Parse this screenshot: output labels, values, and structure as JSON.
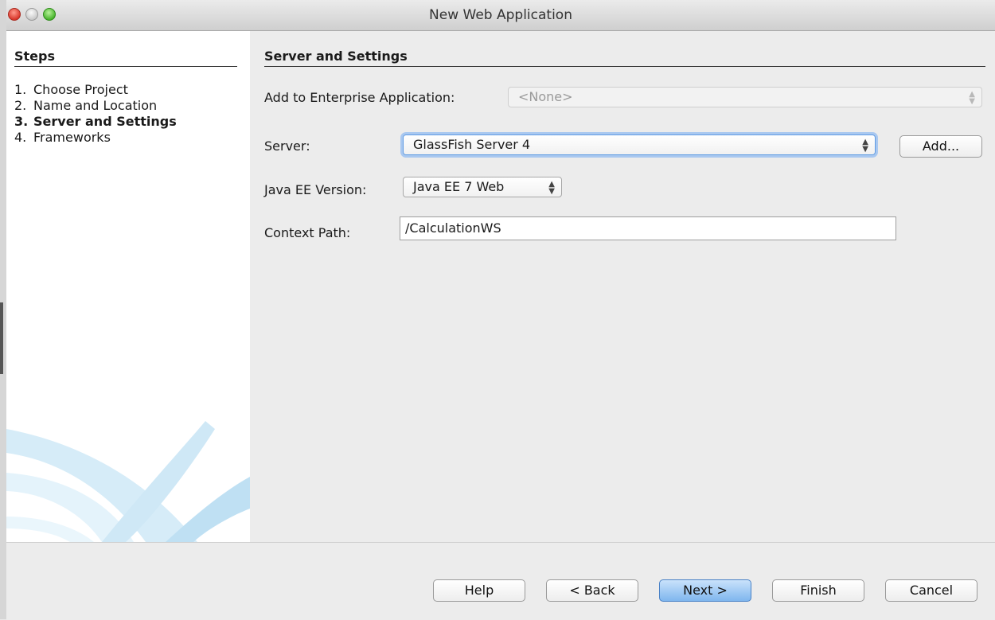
{
  "window": {
    "title": "New Web Application"
  },
  "steps": {
    "header": "Steps",
    "items": [
      {
        "num": "1.",
        "label": "Choose Project"
      },
      {
        "num": "2.",
        "label": "Name and Location"
      },
      {
        "num": "3.",
        "label": "Server and Settings"
      },
      {
        "num": "4.",
        "label": "Frameworks"
      }
    ],
    "current_index": 2
  },
  "section": {
    "title": "Server and Settings"
  },
  "form": {
    "enterprise_label": "Add to Enterprise Application:",
    "enterprise_value": "<None>",
    "server_label": "Server:",
    "server_value": "GlassFish Server 4",
    "add_label": "Add...",
    "javaee_label": "Java EE Version:",
    "javaee_value": "Java EE 7 Web",
    "context_label": "Context Path:",
    "context_value": "/CalculationWS"
  },
  "buttons": {
    "help": "Help",
    "back": "< Back",
    "next": "Next >",
    "finish": "Finish",
    "cancel": "Cancel"
  },
  "colors": {
    "accent": "#7fb6ee",
    "focus": "#5f9be3"
  }
}
